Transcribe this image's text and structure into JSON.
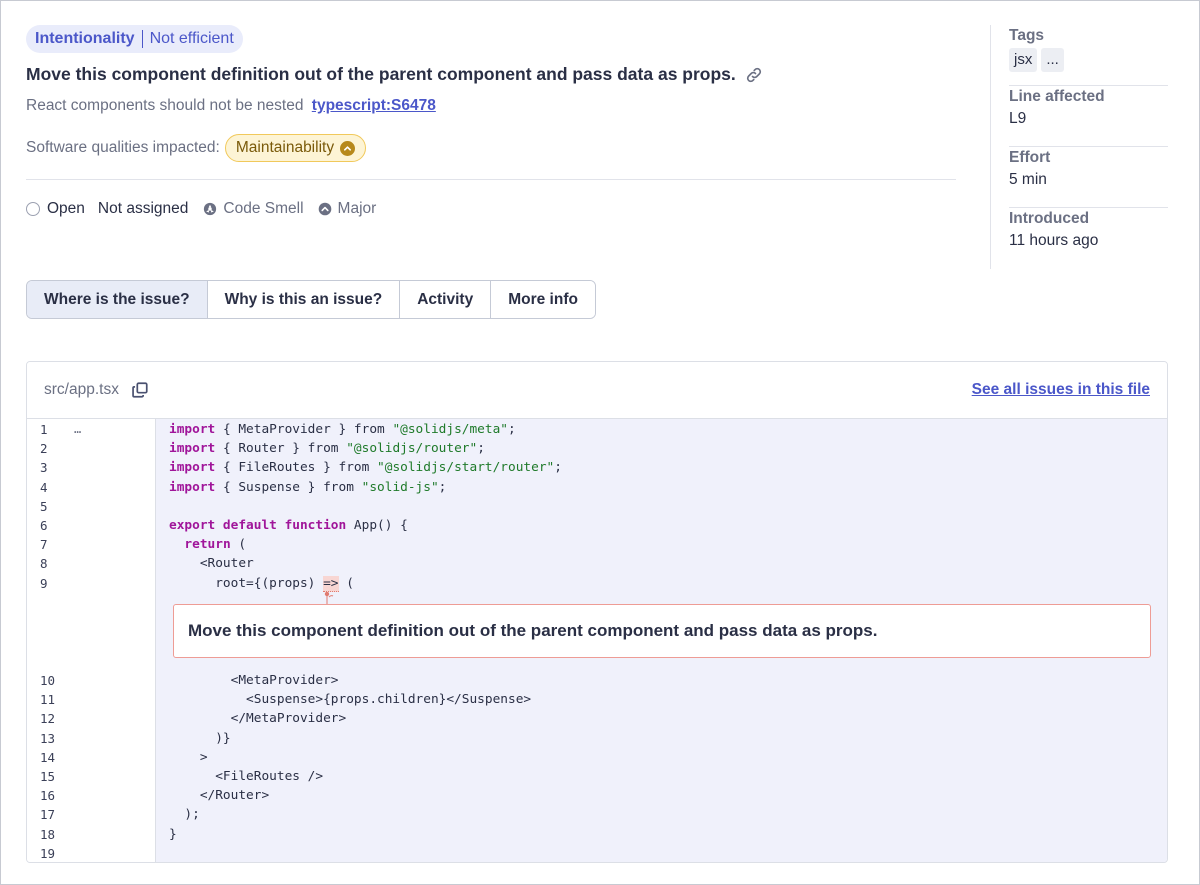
{
  "header": {
    "attribute": "Intentionality",
    "attribute_sub": "Not efficient",
    "title": "Move this component definition out of the parent component and pass data as props.",
    "rule_text": "React components should not be nested",
    "rule_key": "typescript:S6478",
    "qualities_label": "Software qualities impacted:",
    "quality": "Maintainability"
  },
  "status": {
    "state": "Open",
    "assignee": "Not assigned",
    "type": "Code Smell",
    "severity": "Major"
  },
  "sidebar": {
    "tags_label": "Tags",
    "tags": [
      "jsx",
      "..."
    ],
    "line_label": "Line affected",
    "line_value": "L9",
    "effort_label": "Effort",
    "effort_value": "5 min",
    "introduced_label": "Introduced",
    "introduced_value": "11 hours ago"
  },
  "tabs": [
    "Where is the issue?",
    "Why is this an issue?",
    "Activity",
    "More info"
  ],
  "code": {
    "file": "src/app.tsx",
    "see_all": "See all issues in this file",
    "gutter_ellipsis": "…",
    "issue_message": "Move this component definition out of the parent component and pass data as props.",
    "lines": [
      {
        "n": "1",
        "tokens": [
          {
            "t": "import",
            "c": "kw"
          },
          {
            "t": " { MetaProvider } from ",
            "c": "pl"
          },
          {
            "t": "\"@solidjs/meta\"",
            "c": "str"
          },
          {
            "t": ";",
            "c": "pl"
          }
        ]
      },
      {
        "n": "2",
        "tokens": [
          {
            "t": "import",
            "c": "kw"
          },
          {
            "t": " { Router } from ",
            "c": "pl"
          },
          {
            "t": "\"@solidjs/router\"",
            "c": "str"
          },
          {
            "t": ";",
            "c": "pl"
          }
        ]
      },
      {
        "n": "3",
        "tokens": [
          {
            "t": "import",
            "c": "kw"
          },
          {
            "t": " { FileRoutes } from ",
            "c": "pl"
          },
          {
            "t": "\"@solidjs/start/router\"",
            "c": "str"
          },
          {
            "t": ";",
            "c": "pl"
          }
        ]
      },
      {
        "n": "4",
        "tokens": [
          {
            "t": "import",
            "c": "kw"
          },
          {
            "t": " { Suspense } from ",
            "c": "pl"
          },
          {
            "t": "\"solid-js\"",
            "c": "str"
          },
          {
            "t": ";",
            "c": "pl"
          }
        ]
      },
      {
        "n": "5",
        "tokens": []
      },
      {
        "n": "6",
        "tokens": [
          {
            "t": "export default function",
            "c": "kw"
          },
          {
            "t": " App() {",
            "c": "pl"
          }
        ]
      },
      {
        "n": "7",
        "tokens": [
          {
            "t": "  ",
            "c": "pl"
          },
          {
            "t": "return",
            "c": "kw"
          },
          {
            "t": " (",
            "c": "pl"
          }
        ]
      },
      {
        "n": "8",
        "tokens": [
          {
            "t": "    <Router",
            "c": "pl"
          }
        ]
      },
      {
        "n": "9",
        "tokens": [
          {
            "t": "      root={(props) ",
            "c": "pl"
          },
          {
            "t": "=>",
            "c": "hl"
          },
          {
            "t": " (",
            "c": "pl"
          }
        ]
      },
      {
        "n": "10",
        "tokens": [
          {
            "t": "        <MetaProvider>",
            "c": "pl"
          }
        ]
      },
      {
        "n": "11",
        "tokens": [
          {
            "t": "          <Suspense>{props.children}</Suspense>",
            "c": "pl"
          }
        ]
      },
      {
        "n": "12",
        "tokens": [
          {
            "t": "        </MetaProvider>",
            "c": "pl"
          }
        ]
      },
      {
        "n": "13",
        "tokens": [
          {
            "t": "      )}",
            "c": "pl"
          }
        ]
      },
      {
        "n": "14",
        "tokens": [
          {
            "t": "    >",
            "c": "pl"
          }
        ]
      },
      {
        "n": "15",
        "tokens": [
          {
            "t": "      <FileRoutes />",
            "c": "pl"
          }
        ]
      },
      {
        "n": "16",
        "tokens": [
          {
            "t": "    </Router>",
            "c": "pl"
          }
        ]
      },
      {
        "n": "17",
        "tokens": [
          {
            "t": "  );",
            "c": "pl"
          }
        ]
      },
      {
        "n": "18",
        "tokens": [
          {
            "t": "}",
            "c": "pl"
          }
        ]
      },
      {
        "n": "19",
        "tokens": []
      }
    ]
  },
  "icons": {
    "link": "link-icon",
    "copy": "copy-icon",
    "status": "status-open-icon",
    "type": "code-smell-icon",
    "severity": "severity-major-icon"
  },
  "colors": {
    "accent": "#4b57c9",
    "quality_bg": "#fdf4d5",
    "quality_border": "#f1c95b",
    "issue_border": "#ee9c95",
    "code_bg": "#f0f1fb",
    "keyword": "#a0159a",
    "string": "#1f7a2a"
  }
}
